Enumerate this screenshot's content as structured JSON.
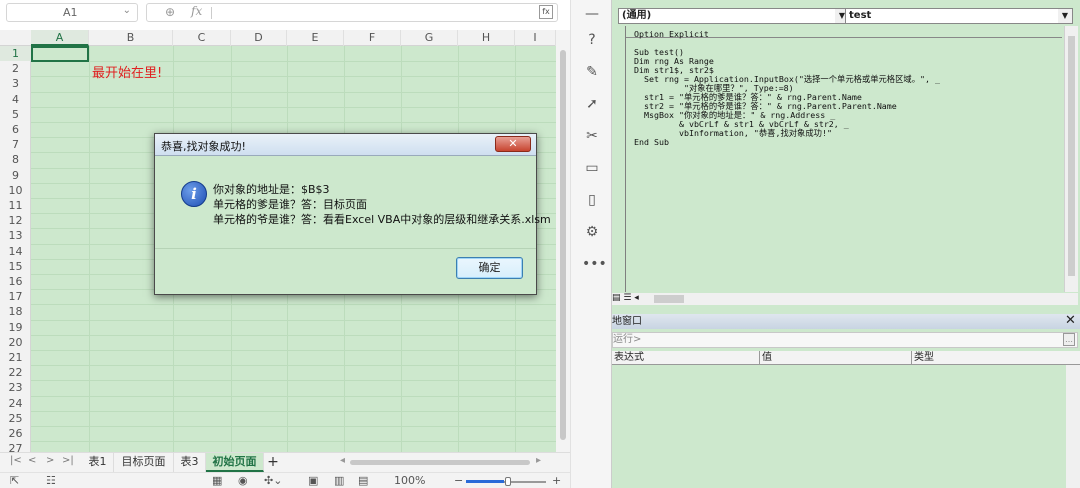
{
  "excel": {
    "namebox": "A1",
    "fx_label": "fx",
    "columns": [
      "A",
      "B",
      "C",
      "D",
      "E",
      "F",
      "G",
      "H",
      "I"
    ],
    "rows": [
      "1",
      "2",
      "3",
      "4",
      "5",
      "6",
      "7",
      "8",
      "9",
      "10",
      "11",
      "12",
      "13",
      "14",
      "15",
      "16",
      "17",
      "18",
      "19",
      "20",
      "21",
      "22",
      "23",
      "24",
      "25",
      "26",
      "27"
    ],
    "cell_b2": "最开始在里!",
    "sheet_tabs": [
      "表1",
      "目标页面",
      "表3",
      "初始页面"
    ],
    "active_tab": "初始页面",
    "add_tab": "+",
    "zoom": "100%"
  },
  "dialog": {
    "title": "恭喜,找对象成功!",
    "close": "✕",
    "line1": "你对象的地址是：$B$3",
    "line2": "单元格的爹是谁？答：目标页面",
    "line3": "单元格的爷是谁？答：看看Excel VBA中对象的层级和继承关系.xlsm",
    "ok_label": "确定"
  },
  "vba": {
    "object_combo": "(通用)",
    "proc_combo": "test",
    "code_lines": [
      "Option Explicit",
      "",
      "Sub test()",
      "Dim rng As Range",
      "Dim str1$, str2$",
      "  Set rng = Application.InputBox(\"选择一个单元格或单元格区域。\", _",
      "          \"对象在哪里？\", Type:=8)",
      "  str1 = \"单元格的爹是谁？答：\" & rng.Parent.Name",
      "  str2 = \"单元格的爷是谁？答：\" & rng.Parent.Parent.Name",
      "  MsgBox \"你对象的地址是：\" & rng.Address _",
      "         & vbCrLf & str1 & vbCrLf & str2, _",
      "         vbInformation, \"恭喜,找对象成功!\"",
      "End Sub"
    ],
    "locals_title": "地窗口",
    "locals_close": "✕",
    "run_hint": "运行>",
    "col_expr": "表达式",
    "col_value": "值",
    "col_type": "类型"
  },
  "colors": {
    "grid_bg": "#cde8cd",
    "accent": "#217346",
    "red_text": "#e02020"
  }
}
